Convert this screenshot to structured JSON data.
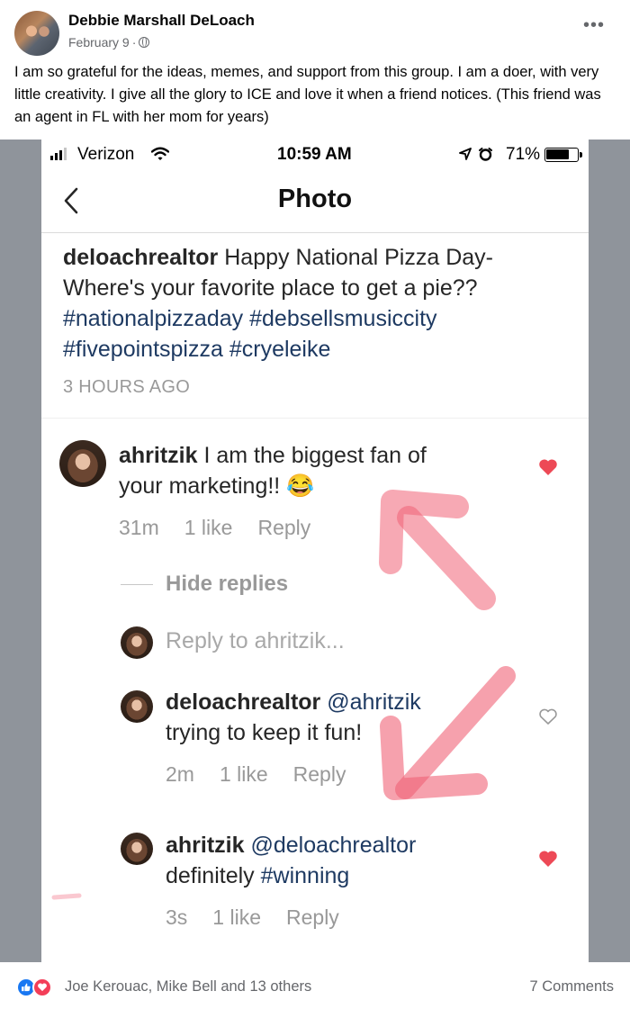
{
  "post": {
    "author": "Debbie Marshall DeLoach",
    "date": "February 9",
    "separator": "·",
    "text": "I am so grateful for the ideas, memes, and support from this group. I am a doer, with very little creativity. I give all the glory to ICE and love it when a friend notices. (This friend was an agent in FL with her mom for years)",
    "more_icon": "•••"
  },
  "phone": {
    "status": {
      "carrier": "Verizon",
      "time": "10:59 AM",
      "battery": "71%"
    },
    "nav": {
      "title": "Photo"
    },
    "caption": {
      "user": "deloachrealtor",
      "text_lines": [
        "Happy National Pizza Day-",
        "Where's your favorite place to get a pie??"
      ],
      "hashtags_line1": [
        "#nationalpizzaday",
        "#debsellsmusiccity"
      ],
      "hashtags_line2": [
        "#fivepointspizza",
        "#cryeleike"
      ],
      "time": "3 HOURS AGO"
    },
    "comments": [
      {
        "user": "ahritzik",
        "text_line1": "I am the biggest fan of",
        "text_line2": "your marketing!!",
        "emoji": "😂",
        "age": "31m",
        "likes": "1 like",
        "reply": "Reply",
        "liked": true
      },
      {
        "user": "deloachrealtor",
        "mention": "@ahritzik",
        "text": "trying to keep it fun!",
        "age": "2m",
        "likes": "1 like",
        "reply": "Reply",
        "liked": false
      },
      {
        "user": "ahritzik",
        "mention": "@deloachrealtor",
        "text_plain": "definitely",
        "hashtag": "#winning",
        "age": "3s",
        "likes": "1 like",
        "reply": "Reply",
        "liked": true
      }
    ],
    "hide_replies": "Hide replies",
    "reply_to": "Reply to ahritzik...",
    "colors": {
      "heart_red": "#ed4956",
      "hashtag_blue": "#1e3a62",
      "arrow_pink": "#f06277"
    }
  },
  "footer": {
    "reactors": "Joe Kerouac, Mike Bell and 13 others",
    "comments": "7 Comments"
  }
}
